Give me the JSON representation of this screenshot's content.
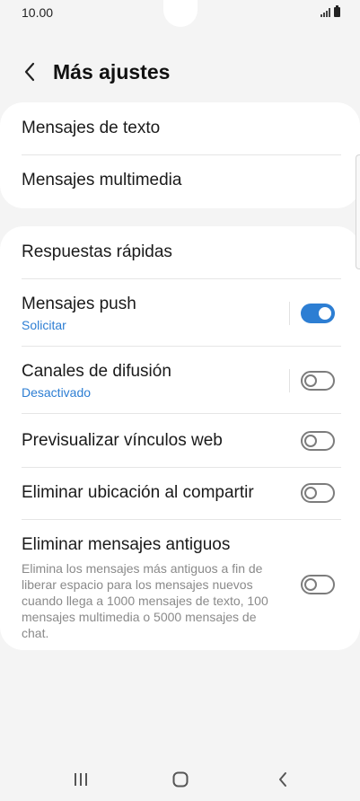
{
  "status_bar": {
    "time": "10.00",
    "icons": [
      "signal-icon",
      "battery-icon"
    ]
  },
  "header": {
    "title": "Más ajustes",
    "back_icon": "chevron-left-icon"
  },
  "groups": [
    {
      "items": [
        {
          "title": "Mensajes de texto"
        },
        {
          "title": "Mensajes multimedia"
        }
      ]
    },
    {
      "items": [
        {
          "title": "Respuestas rápidas"
        },
        {
          "title": "Mensajes push",
          "subtitle": "Solicitar",
          "toggle": true
        },
        {
          "title": "Canales de difusión",
          "subtitle": "Desactivado",
          "toggle": false
        },
        {
          "title": "Previsualizar vínculos web",
          "toggle": false
        },
        {
          "title": "Eliminar ubicación al compartir",
          "toggle": false
        },
        {
          "title": "Eliminar mensajes antiguos",
          "description": "Elimina los mensajes más antiguos a fin de liberar espacio para los mensajes nuevos cuando llega a 1000 mensajes de texto, 100 mensajes multimedia o 5000 mensajes de chat.",
          "toggle": false
        }
      ]
    }
  ],
  "nav_bar": {
    "icons": [
      "recents-icon",
      "home-icon",
      "back-icon"
    ]
  },
  "colors": {
    "accent": "#2d7ed3",
    "background": "#f4f4f4",
    "card": "#ffffff",
    "toggle_off": "#7c7c7c"
  }
}
